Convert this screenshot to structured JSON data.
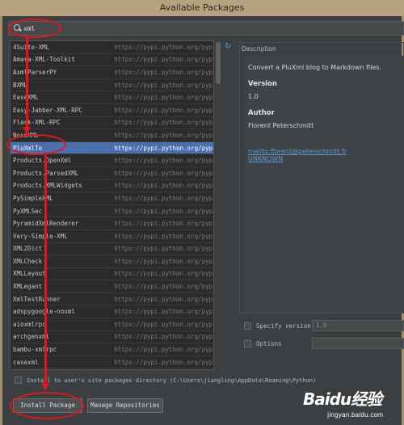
{
  "window": {
    "title": "Available Packages"
  },
  "search": {
    "value": "xml"
  },
  "packages": [
    {
      "name": "4Suite-XML",
      "repo": "https://pypi.python.org/pypi"
    },
    {
      "name": "Amara-XML-Toolkit",
      "repo": "https://pypi.python.org/pypi"
    },
    {
      "name": "AxmlParserPY",
      "repo": "https://pypi.python.org/pypi"
    },
    {
      "name": "BXML",
      "repo": "https://pypi.python.org/pypi"
    },
    {
      "name": "EaseXML",
      "repo": "https://pypi.python.org/pypi"
    },
    {
      "name": "Easy-Jabber-XML-RPC",
      "repo": "https://pypi.python.org/pypi"
    },
    {
      "name": "Flask-XML-RPC",
      "repo": "https://pypi.python.org/pypi"
    },
    {
      "name": "NoseXML",
      "repo": "https://pypi.python.org/pypi"
    },
    {
      "name": "PluXmlTo",
      "repo": "https://pypi.python.org/pypi"
    },
    {
      "name": "Products.OpenXml",
      "repo": "https://pypi.python.org/pypi"
    },
    {
      "name": "Products.ParsedXML",
      "repo": "https://pypi.python.org/pypi"
    },
    {
      "name": "Products.XMLWidgets",
      "repo": "https://pypi.python.org/pypi"
    },
    {
      "name": "PySimpleXML",
      "repo": "https://pypi.python.org/pypi"
    },
    {
      "name": "PyXMLSec",
      "repo": "https://pypi.python.org/pypi"
    },
    {
      "name": "PyramidXmlRenderer",
      "repo": "https://pypi.python.org/pypi"
    },
    {
      "name": "Very-Simple-XML",
      "repo": "https://pypi.python.org/pypi"
    },
    {
      "name": "XML2Dict",
      "repo": "https://pypi.python.org/pypi"
    },
    {
      "name": "XMLCheck",
      "repo": "https://pypi.python.org/pypi"
    },
    {
      "name": "XMLLayout",
      "repo": "https://pypi.python.org/pypi"
    },
    {
      "name": "XMLegant",
      "repo": "https://pypi.python.org/pypi"
    },
    {
      "name": "XmlTestRunner",
      "repo": "https://pypi.python.org/pypi"
    },
    {
      "name": "adspygoogle-noxml",
      "repo": "https://pypi.python.org/pypi"
    },
    {
      "name": "aioxmlrpc",
      "repo": "https://pypi.python.org/pypi"
    },
    {
      "name": "archgenxml",
      "repo": "https://pypi.python.org/pypi"
    },
    {
      "name": "bambu-xmlrpc",
      "repo": "https://pypi.python.org/pypi"
    },
    {
      "name": "casexml",
      "repo": "https://pypi.python.org/pypi"
    },
    {
      "name": "collective.gsxml",
      "repo": "https://pypi.python.org/pypi"
    }
  ],
  "selected_package": "PluXmlTo",
  "description": {
    "legend": "Description",
    "summary": "Convert a PluXml blog to Markdown files.",
    "version_label": "Version",
    "version": "1.0",
    "author_label": "Author",
    "author": "Florent Peterschmitt",
    "email_link": "mailto:florent@peterschmitt.fr",
    "homepage_link": "UNKNOWN"
  },
  "options": {
    "specify_version_label": "Specify version",
    "specify_version_value": "1.0",
    "options_label": "Options",
    "user_site_label": "Install to user's site packages directory (C:\\Users\\jiangling\\AppData\\Roaming\\Python)"
  },
  "buttons": {
    "install": "Install Package",
    "manage": "Manage Repositories"
  },
  "watermark": {
    "logo": "Baidu经验",
    "url": "jingyan.baidu.com"
  },
  "colors": {
    "annotation": "#e4151b",
    "selection": "#4b6eaf",
    "link": "#5b9bd5"
  }
}
